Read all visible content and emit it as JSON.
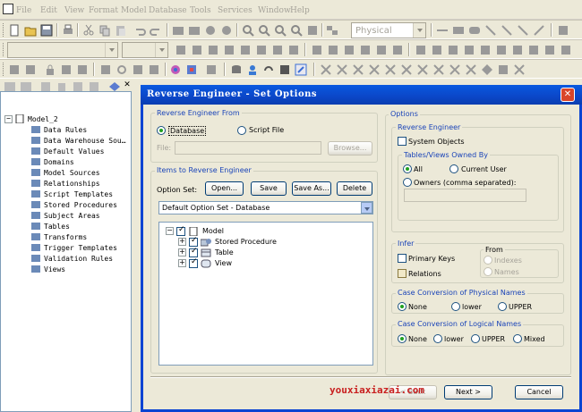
{
  "menu": [
    "File",
    "Edit",
    "View",
    "Format",
    "Model",
    "Database",
    "Tools",
    "Services",
    "Window",
    "Help"
  ],
  "toolbar": {
    "model_type": "Physical"
  },
  "tree": {
    "root": "Model_2",
    "items": [
      "Data Rules",
      "Data Warehouse Sou…",
      "Default Values",
      "Domains",
      "Model Sources",
      "Relationships",
      "Script Templates",
      "Stored Procedures",
      "Subject Areas",
      "Tables",
      "Transforms",
      "Trigger Templates",
      "Validation Rules",
      "Views"
    ]
  },
  "dialog": {
    "title": "Reverse Engineer - Set Options",
    "reverse_from": {
      "legend": "Reverse Engineer From",
      "database": "Database",
      "script_file": "Script File",
      "file_label": "File:",
      "browse": "Browse..."
    },
    "items": {
      "legend": "Items to Reverse Engineer",
      "option_set_label": "Option Set:",
      "open": "Open...",
      "save": "Save",
      "save_as": "Save As...",
      "delete": "Delete",
      "selected_option_set": "Default Option Set - Database",
      "tree_root": "Model",
      "tree_children": [
        "Stored Procedure",
        "Table",
        "View"
      ]
    },
    "options": {
      "legend": "Options",
      "reverse_engineer": {
        "legend": "Reverse Engineer",
        "system_objects": "System Objects",
        "tables_views_owned_by": "Tables/Views Owned By",
        "all": "All",
        "current_user": "Current User",
        "owners": "Owners (comma separated):"
      },
      "infer": {
        "legend": "Infer",
        "primary_keys": "Primary Keys",
        "relations": "Relations",
        "from": "From",
        "indexes": "Indexes",
        "names": "Names"
      },
      "case_physical": {
        "legend": "Case Conversion of Physical Names",
        "none": "None",
        "lower": "lower",
        "upper": "UPPER"
      },
      "case_logical": {
        "legend": "Case Conversion of Logical Names",
        "none": "None",
        "lower": "lower",
        "upper": "UPPER",
        "mixed": "Mixed"
      }
    },
    "footer": {
      "back": "< Back",
      "next": "Next >",
      "cancel": "Cancel"
    }
  },
  "watermark": "youxiaxiazai.com",
  "colors": {
    "title_bar": "#0a4bd0",
    "group_label": "#1a44b8",
    "radio_dot": "#21a121",
    "watermark": "#c81e1e"
  }
}
